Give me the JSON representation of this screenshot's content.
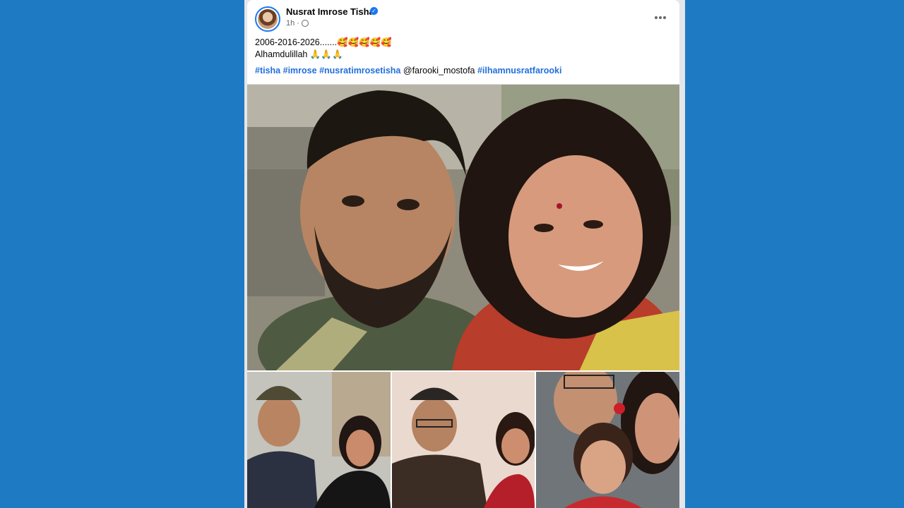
{
  "post": {
    "author_name": "Nusrat Imrose Tisha",
    "verified_mark": "✓",
    "timestamp": "1h",
    "separator": "·",
    "privacy_icon": "globe-icon",
    "caption_line1": "2006-2016-2026.......🥰🥰🥰🥰🥰",
    "caption_line2": "Alhamdulillah 🙏🙏🙏",
    "hashtags": [
      "#tisha",
      "#imrose",
      "#nusratimrosetisha"
    ],
    "mention": "@farooki_mostofa",
    "hashtag_last": "#ilhamnusratfarooki"
  },
  "colors": {
    "background": "#1f7ac4",
    "link": "#216fdb",
    "verified": "#1877f2"
  }
}
